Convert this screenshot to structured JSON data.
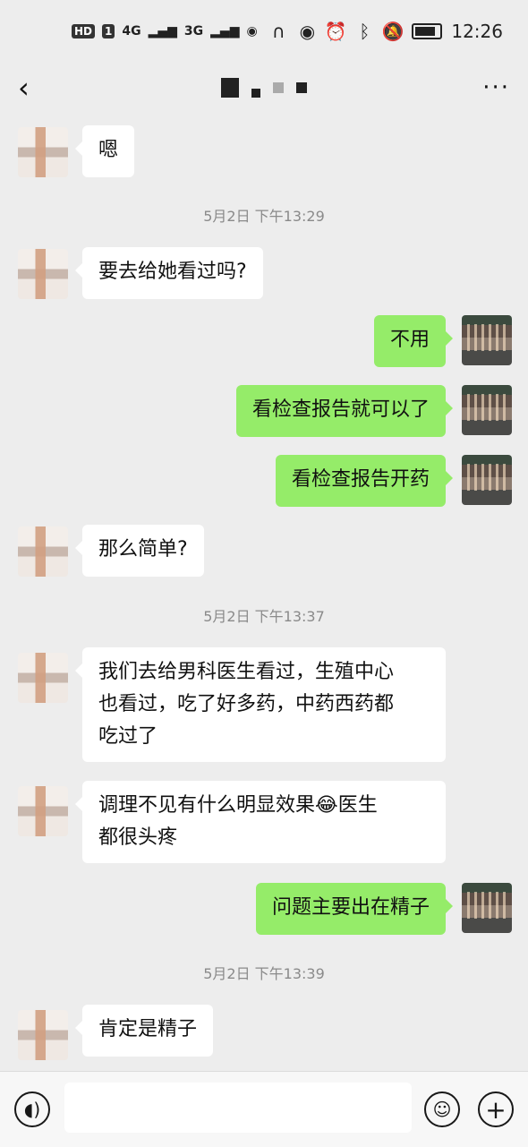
{
  "status_bar": {
    "hd": "HD",
    "sim": "1",
    "net1": "4G",
    "net2": "3G",
    "time": "12:26"
  },
  "nav": {
    "back_icon": "chevron-left-icon",
    "more_label": "···"
  },
  "messages": [
    {
      "side": "in",
      "text": "嗯"
    },
    {
      "timestamp": "5月2日 下午13:29"
    },
    {
      "side": "in",
      "text": "要去给她看过吗?"
    },
    {
      "side": "out",
      "text": "不用"
    },
    {
      "side": "out",
      "text": "看检查报告就可以了"
    },
    {
      "side": "out",
      "text": "看检查报告开药"
    },
    {
      "side": "in",
      "text": "那么简单?"
    },
    {
      "timestamp": "5月2日 下午13:37"
    },
    {
      "side": "in",
      "lines": [
        "我们去给男科医生看过，生殖中心",
        "也看过，吃了好多药，中药西药都",
        "吃过了"
      ]
    },
    {
      "side": "in",
      "lines": [
        "调理不见有什么明显效果😂医生",
        "都很头疼"
      ]
    },
    {
      "side": "out",
      "text": "问题主要出在精子"
    },
    {
      "timestamp": "5月2日 下午13:39"
    },
    {
      "side": "in",
      "text": "肯定是精子"
    }
  ],
  "input_bar": {
    "voice_icon": "voice-icon",
    "emoji_icon": "emoji-icon",
    "plus_icon": "plus-icon"
  }
}
